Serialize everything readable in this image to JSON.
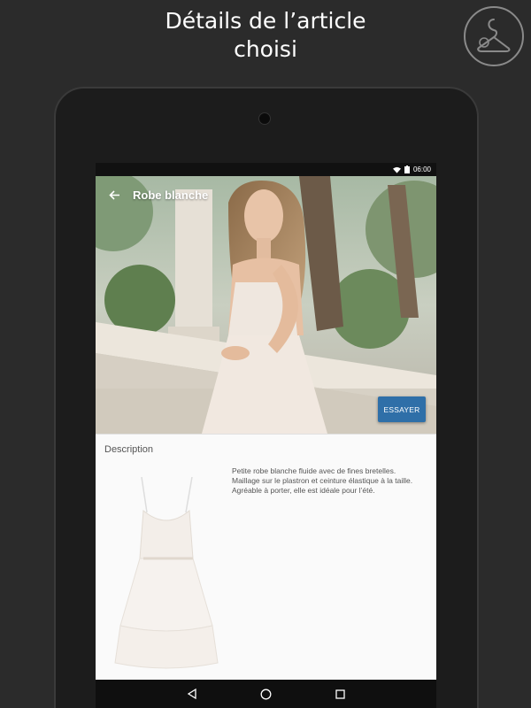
{
  "headline": {
    "line1": "Détails de l’article",
    "line2": "choisi"
  },
  "status_bar": {
    "time": "06:00",
    "icons": [
      "wifi-icon",
      "battery-icon"
    ]
  },
  "app_bar": {
    "back_icon": "arrow-left-icon",
    "title": "Robe blanche"
  },
  "hero": {
    "action_label": "ESSAYER",
    "action_color": "#2f6fa8"
  },
  "description": {
    "label": "Description",
    "lines": [
      "Petite robe blanche fluide avec de fines bretelles.",
      "Maillage sur le plastron et ceinture élastique à la taille.",
      "Agréable à porter, elle est idéale pour l’été."
    ]
  },
  "nav_bar": {
    "icons": [
      "back-triangle-icon",
      "home-circle-icon",
      "recents-square-icon"
    ]
  },
  "colors": {
    "page_bg": "#2b2b2b",
    "accent": "#2f6fa8"
  }
}
